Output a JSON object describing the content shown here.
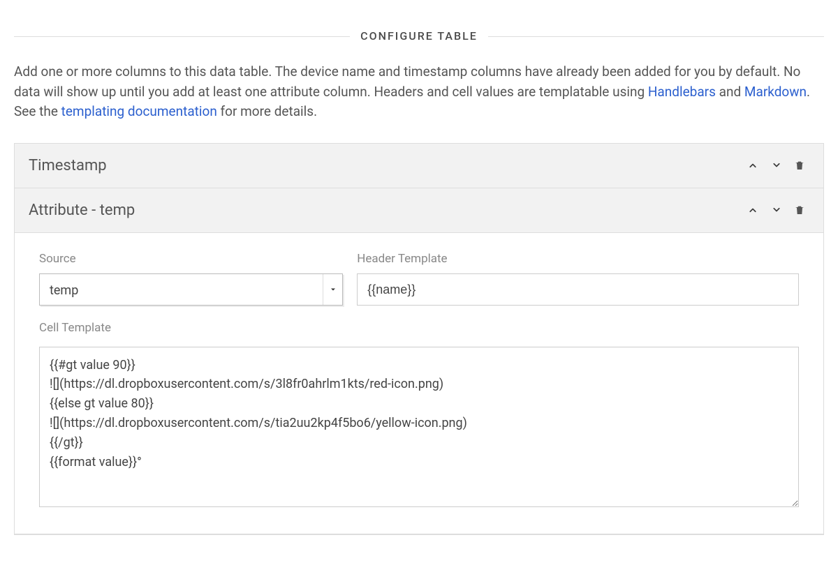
{
  "section_title": "CONFIGURE TABLE",
  "description": {
    "part1": "Add one or more columns to this data table. The device name and timestamp columns have already been added for you by default. No data will show up until you add at least one attribute column. Headers and cell values are templatable using ",
    "link1": "Handlebars",
    "part2": " and ",
    "link2": "Markdown",
    "part3": ". See the ",
    "link3": "templating documentation",
    "part4": " for more details."
  },
  "columns": [
    {
      "title": "Timestamp"
    },
    {
      "title": "Attribute - temp"
    }
  ],
  "form": {
    "source_label": "Source",
    "source_value": "temp",
    "header_template_label": "Header Template",
    "header_template_value": "{{name}}",
    "cell_template_label": "Cell Template",
    "cell_template_value": "{{#gt value 90}}\n![](https://dl.dropboxusercontent.com/s/3l8fr0ahrlm1kts/red-icon.png)\n{{else gt value 80}}\n![](https://dl.dropboxusercontent.com/s/tia2uu2kp4f5bo6/yellow-icon.png)\n{{/gt}}\n{{format value}}°"
  }
}
